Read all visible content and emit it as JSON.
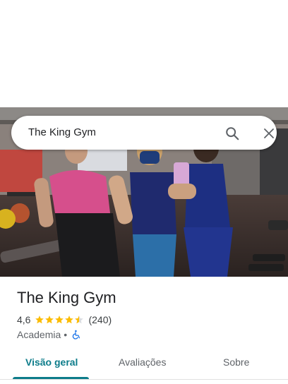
{
  "search": {
    "query": "The King Gym"
  },
  "place": {
    "name": "The King Gym",
    "rating": "4,6",
    "stars_filled": 4.5,
    "review_count": "(240)",
    "category": "Academia",
    "separator": "•"
  },
  "tabs": [
    {
      "label": "Visão geral",
      "active": true
    },
    {
      "label": "Avaliações",
      "active": false
    },
    {
      "label": "Sobre",
      "active": false
    }
  ],
  "colors": {
    "accent": "#0d7c8a",
    "star": "#fbbc04",
    "accessibility_icon": "#1a73e8"
  },
  "icons": {
    "search": "search-icon",
    "close": "close-icon",
    "star": "star-icon",
    "accessibility": "wheelchair-icon"
  }
}
